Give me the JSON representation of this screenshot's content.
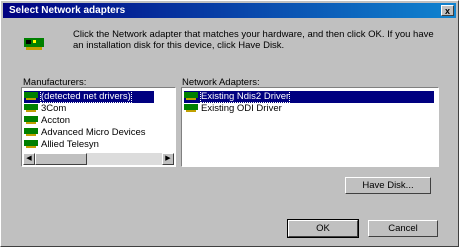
{
  "window": {
    "title": "Select Network adapters",
    "close_glyph": "x"
  },
  "instructions": "Click the Network adapter that matches your hardware, and then click OK. If you have an installation disk for this device, click Have Disk.",
  "manufacturers": {
    "label": "Manufacturers:",
    "items": [
      {
        "label": "(detected net drivers)",
        "selected": true
      },
      {
        "label": "3Com",
        "selected": false
      },
      {
        "label": "Accton",
        "selected": false
      },
      {
        "label": "Advanced Micro Devices",
        "selected": false
      },
      {
        "label": "Allied Telesyn",
        "selected": false
      }
    ]
  },
  "adapters": {
    "label": "Network Adapters:",
    "items": [
      {
        "label": "Existing Ndis2 Driver",
        "selected": true
      },
      {
        "label": "Existing ODI Driver",
        "selected": false
      }
    ]
  },
  "buttons": {
    "have_disk": "Have Disk...",
    "ok": "OK",
    "cancel": "Cancel"
  },
  "icons": {
    "header": "network-card-icon",
    "list_item": "network-card-icon"
  }
}
